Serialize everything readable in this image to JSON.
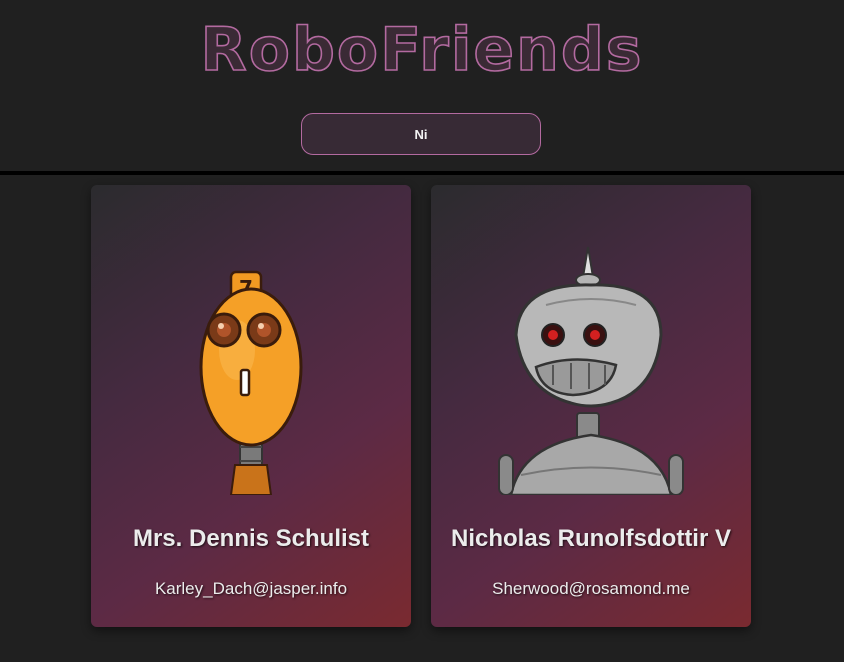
{
  "app": {
    "title": "RoboFriends"
  },
  "search": {
    "value": "Ni"
  },
  "robots": [
    {
      "name": "Mrs. Dennis Schulist",
      "email": "Karley_Dach@jasper.info"
    },
    {
      "name": "Nicholas Runolfsdottir V",
      "email": "Sherwood@rosamond.me"
    }
  ],
  "colors": {
    "background": "#202020",
    "accent": "#b36aa0",
    "title": "#3a2a35",
    "text": "#ececec"
  }
}
